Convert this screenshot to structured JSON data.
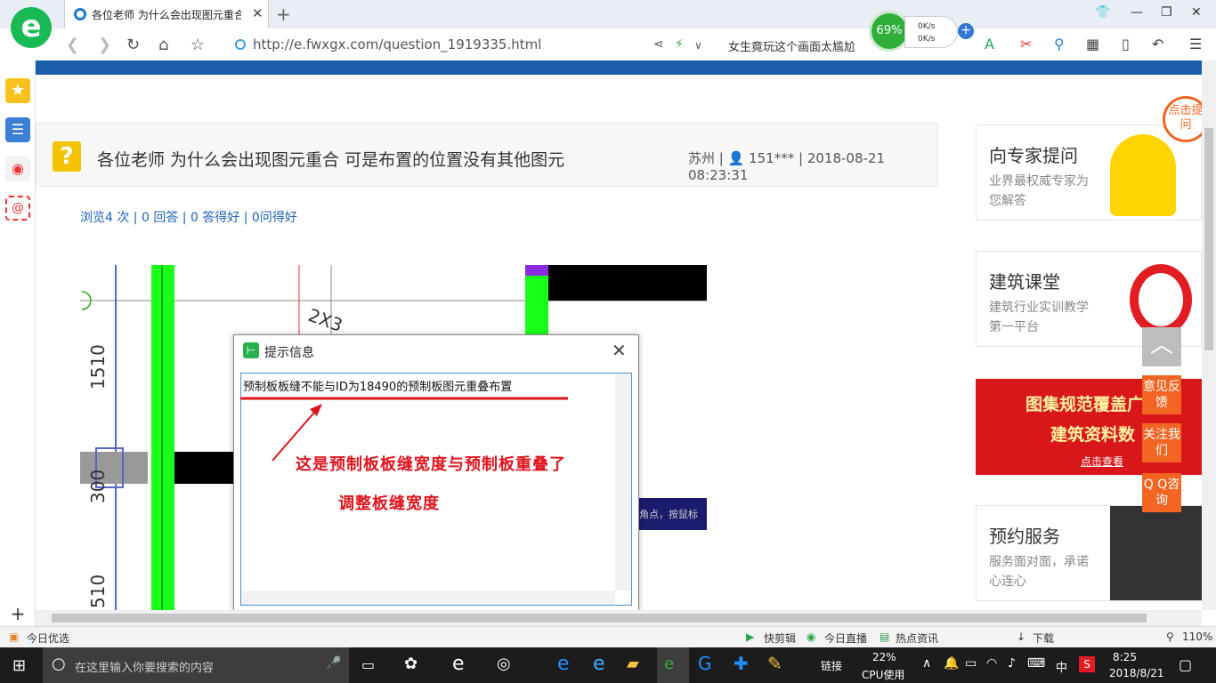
{
  "browser": {
    "tab_title": "各位老师 为什么会出现图元重合",
    "url": "http://e.fwxgx.com/question_1919335.html",
    "search_hint": "女生竟玩这个画面太尴尬",
    "speed": {
      "cpu_percent": "69%",
      "up": "0K/s",
      "down": "0K/s"
    }
  },
  "question": {
    "title": "各位老师 为什么会出现图元重合 可是布置的位置没有其他图元",
    "location": "苏州",
    "user": "151***",
    "datetime": "2018-08-21 08:23:31",
    "stats": "浏览4 次 | 0 回答 | 0 答得好 | 0问得好"
  },
  "cad": {
    "dim_top": "1510",
    "dim_mid": "300",
    "dim_bottom": "510",
    "partial_label": "2X3",
    "command_hint": "角点，按鼠标"
  },
  "dialog": {
    "title": "提示信息",
    "message": "预制板板缝不能与ID为18490的预制板图元重叠布置"
  },
  "annotation": {
    "line1": "这是预制板板缝宽度与预制板重叠了",
    "line2": "调整板缝宽度"
  },
  "right_panel": {
    "card1": {
      "title": "向专家提问",
      "sub": "业界最权威专家为您解答"
    },
    "card2": {
      "title": "建筑课堂",
      "sub": "建筑行业实训教学第一平台"
    },
    "banner": {
      "line1": "图集规范覆盖广",
      "line2": "建筑资料数",
      "link": "点击查看"
    },
    "card3": {
      "title": "预约服务",
      "sub": "服务面对面，承诺心连心"
    },
    "badge": "点击提问"
  },
  "floating": {
    "feedback": "意见反馈",
    "follow": "关注我们",
    "qq": "Q Q咨询"
  },
  "statusbar": {
    "left": "今日优选",
    "items": [
      "快剪辑",
      "今日直播",
      "热点资讯",
      "下载"
    ],
    "zoom": "110%"
  },
  "taskbar": {
    "search_placeholder": "在这里输入你要搜索的内容",
    "link_label": "链接",
    "cpu": "22%",
    "cpu_label": "CPU使用",
    "ime": "中",
    "time": "8:25",
    "date": "2018/8/21"
  }
}
